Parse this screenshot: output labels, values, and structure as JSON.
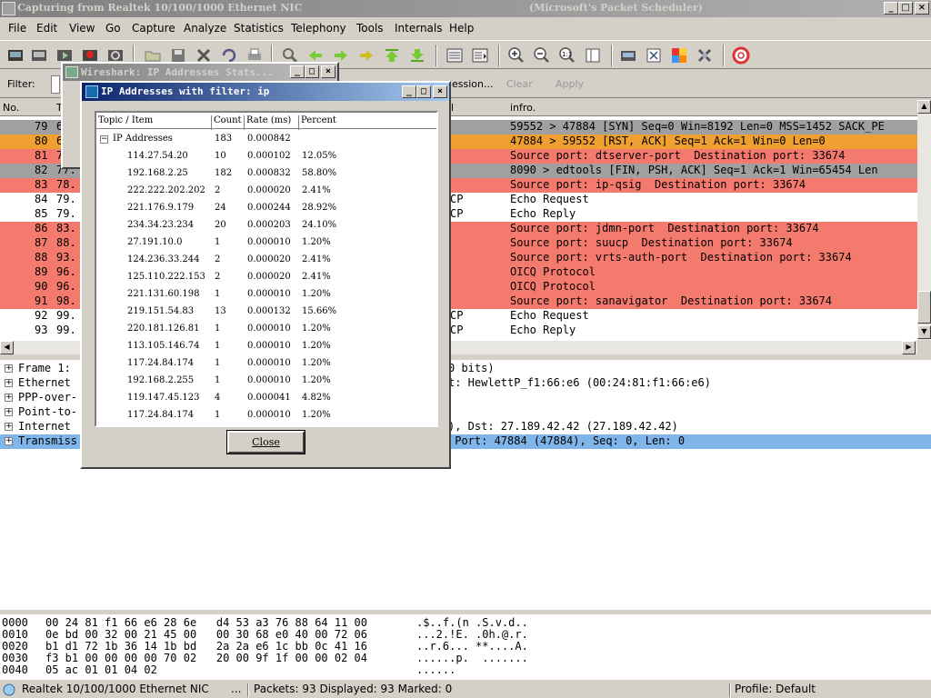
{
  "window": {
    "title": "Capturing from Realtek 10/100/1000 Ethernet NIC",
    "subtitle": "(Microsoft's Packet Scheduler)",
    "minimize": "_",
    "maximize": "□",
    "close": "×"
  },
  "menu": [
    "File",
    "Edit",
    "View",
    "Go",
    "Capture",
    "Analyze",
    "Statistics",
    "Telephony",
    "Tools",
    "Internals",
    "Help"
  ],
  "filter": {
    "label": "Filter:",
    "expression": "ession...",
    "clear": "Clear",
    "apply": "Apply"
  },
  "packet_list": {
    "headers": {
      "no": "No.",
      "time": "T",
      "protocol": "l",
      "info": "infro."
    },
    "rows": [
      {
        "no": "79",
        "time": "6",
        "proto": "",
        "info": "59552 > 47884 [SYN] Seq=0 Win=8192 Len=0 MSS=1452 SACK_PE",
        "bg": "#a0a0a0"
      },
      {
        "no": "80",
        "time": "6",
        "proto": "",
        "info": "47884 > 59552 [RST, ACK] Seq=1 Ack=1 Win=0 Len=0",
        "bg": "#f0a030"
      },
      {
        "no": "81",
        "time": "7.",
        "proto": "",
        "info": "Source port: dtserver-port  Destination port: 33674",
        "bg": "#f57a6e"
      },
      {
        "no": "82",
        "time": "77.",
        "proto": "",
        "info": "8090 > edtools [FIN, PSH, ACK] Seq=1 Ack=1 Win=65454 Len",
        "bg": "#a0a0a0"
      },
      {
        "no": "83",
        "time": "78.",
        "proto": "",
        "info": "Source port: ip-qsig  Destination port: 33674",
        "bg": "#f57a6e"
      },
      {
        "no": "84",
        "time": "79.",
        "proto": "CP",
        "info": "Echo Request",
        "bg": "#ffffff"
      },
      {
        "no": "85",
        "time": "79.",
        "proto": "CP",
        "info": "Echo Reply",
        "bg": "#ffffff"
      },
      {
        "no": "86",
        "time": "83.",
        "proto": "",
        "info": "Source port: jdmn-port  Destination port: 33674",
        "bg": "#f57a6e"
      },
      {
        "no": "87",
        "time": "88.",
        "proto": "",
        "info": "Source port: suucp  Destination port: 33674",
        "bg": "#f57a6e"
      },
      {
        "no": "88",
        "time": "93.",
        "proto": "",
        "info": "Source port: vrts-auth-port  Destination port: 33674",
        "bg": "#f57a6e"
      },
      {
        "no": "89",
        "time": "96.",
        "proto": "",
        "info": "OICQ Protocol",
        "bg": "#f57a6e"
      },
      {
        "no": "90",
        "time": "96.",
        "proto": "",
        "info": "OICQ Protocol",
        "bg": "#f57a6e"
      },
      {
        "no": "91",
        "time": "98.",
        "proto": "",
        "info": "Source port: sanavigator  Destination port: 33674",
        "bg": "#f57a6e"
      },
      {
        "no": "92",
        "time": "99.",
        "proto": "CP",
        "info": "Echo Request",
        "bg": "#ffffff"
      },
      {
        "no": "93",
        "time": "99.",
        "proto": "CP",
        "info": "Echo Reply",
        "bg": "#ffffff"
      }
    ]
  },
  "details": [
    {
      "left": "Frame 1:",
      "right": "0 bits)",
      "selected": false
    },
    {
      "left": "Ethernet",
      "right": "t: HewlettP_f1:66:e6 (00:24:81:f1:66:e6)",
      "selected": false
    },
    {
      "left": "PPP-over-",
      "right": "",
      "selected": false
    },
    {
      "left": "Point-to-",
      "right": "",
      "selected": false
    },
    {
      "left": "Internet",
      "right": "), Dst: 27.189.42.42 (27.189.42.42)",
      "selected": false
    },
    {
      "left": "Transmiss",
      "right": " Port: 47884 (47884), Seq: 0, Len: 0",
      "selected": true
    }
  ],
  "bytes": [
    {
      "off": "0000",
      "hex": "00 24 81 f1 66 e6 28 6e   d4 53 a3 76 88 64 11 00",
      "ascii": ".$..f.(n .S.v.d.."
    },
    {
      "off": "0010",
      "hex": "0e bd 00 32 00 21 45 00   00 30 68 e0 40 00 72 06",
      "ascii": "...2.!E. .0h.@.r."
    },
    {
      "off": "0020",
      "hex": "b1 d1 72 1b 36 14 1b bd   2a 2a e6 1c bb 0c 41 16",
      "ascii": "..r.6... **....A."
    },
    {
      "off": "0030",
      "hex": "f3 b1 00 00 00 00 70 02   20 00 9f 1f 00 00 02 04",
      "ascii": "......p.  ......."
    },
    {
      "off": "0040",
      "hex": "05 ac 01 01 04 02",
      "ascii": "......"
    }
  ],
  "status": {
    "interface": "Realtek 10/100/1000 Ethernet NIC",
    "ellipsis": "...",
    "packets": "Packets: 93 Displayed: 93 Marked: 0",
    "profile": "Profile: Default"
  },
  "dialog_back": {
    "title": "Wireshark: IP Addresses Stats..."
  },
  "dialog": {
    "title": "IP Addresses with filter: ip",
    "headers": {
      "topic": "Topic / Item",
      "count": "Count",
      "rate": "Rate (ms)",
      "percent": "Percent"
    },
    "root": {
      "label": "IP Addresses",
      "count": "183",
      "rate": "0.000842",
      "percent": ""
    },
    "items": [
      {
        "ip": "114.27.54.20",
        "count": "10",
        "rate": "0.000102",
        "percent": "12.05%"
      },
      {
        "ip": "192.168.2.25",
        "count": "182",
        "rate": "0.000832",
        "percent": "58.80%"
      },
      {
        "ip": "222.222.202.202",
        "count": "2",
        "rate": "0.000020",
        "percent": "2.41%"
      },
      {
        "ip": "221.176.9.179",
        "count": "24",
        "rate": "0.000244",
        "percent": "28.92%"
      },
      {
        "ip": "234.34.23.234",
        "count": "20",
        "rate": "0.000203",
        "percent": "24.10%"
      },
      {
        "ip": "27.191.10.0",
        "count": "1",
        "rate": "0.000010",
        "percent": "1.20%"
      },
      {
        "ip": "124.236.33.244",
        "count": "2",
        "rate": "0.000020",
        "percent": "2.41%"
      },
      {
        "ip": "125.110.222.153",
        "count": "2",
        "rate": "0.000020",
        "percent": "2.41%"
      },
      {
        "ip": "221.131.60.198",
        "count": "1",
        "rate": "0.000010",
        "percent": "1.20%"
      },
      {
        "ip": "219.151.54.83",
        "count": "13",
        "rate": "0.000132",
        "percent": "15.66%"
      },
      {
        "ip": "220.181.126.81",
        "count": "1",
        "rate": "0.000010",
        "percent": "1.20%"
      },
      {
        "ip": "113.105.146.74",
        "count": "1",
        "rate": "0.000010",
        "percent": "1.20%"
      },
      {
        "ip": "117.24.84.174",
        "count": "1",
        "rate": "0.000010",
        "percent": "1.20%"
      },
      {
        "ip": "192.168.2.255",
        "count": "1",
        "rate": "0.000010",
        "percent": "1.20%"
      },
      {
        "ip": "119.147.45.123",
        "count": "4",
        "rate": "0.000041",
        "percent": "4.82%"
      },
      {
        "ip": "117.24.84.174",
        "count": "1",
        "rate": "0.000010",
        "percent": "1.20%"
      }
    ],
    "close_label": "Close"
  }
}
